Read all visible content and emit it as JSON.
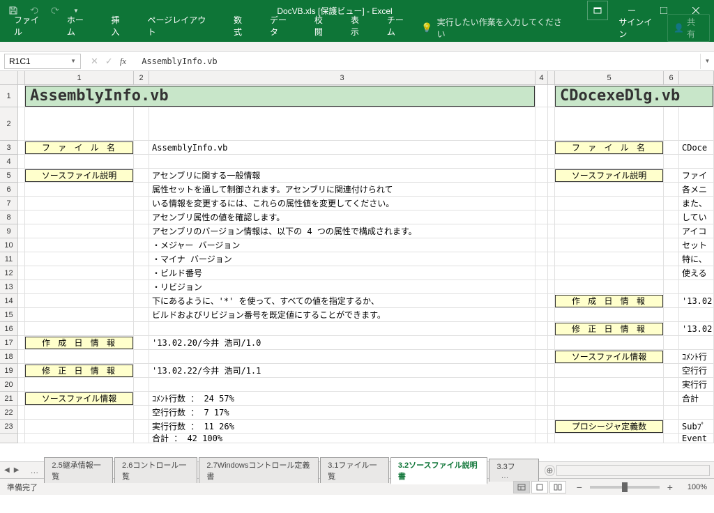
{
  "title": "DocVB.xls [保護ビュー] - Excel",
  "ribbon": {
    "tabs": [
      "ファイル",
      "ホーム",
      "挿入",
      "ページレイアウト",
      "数式",
      "データ",
      "校閲",
      "表示",
      "チーム"
    ],
    "tellme": "実行したい作業を入力してください",
    "signin": "サインイン",
    "share": "共有"
  },
  "namebox": "R1C1",
  "formula": "AssemblyInfo.vb",
  "cols": [
    "1",
    "2",
    "3",
    "4",
    "5",
    "6"
  ],
  "rows": {
    "left_header": "AssemblyInfo.vb",
    "right_header": "CDocexeDlg.vb",
    "labels": {
      "file_name": "フ ァ イ ル 名",
      "src_desc": "ソースファイル説明",
      "create_date": "作 成 日 情 報",
      "modify_date": "修 正 日 情 報",
      "src_info": "ソースファイル情報",
      "proc_def": "プロシージャ定義数"
    },
    "r3": {
      "c3": "AssemblyInfo.vb",
      "c9": "CDoce"
    },
    "r5": {
      "c3": "アセンブリに関する一般情報",
      "c9": "ファイ"
    },
    "r6": {
      "c3": "属性セットを通して制御されます。アセンブリに関連付けられて",
      "c9": "各メニ"
    },
    "r7": {
      "c3": "いる情報を変更するには、これらの属性値を変更してください。",
      "c9": "また、"
    },
    "r8": {
      "c3": "アセンブリ属性の値を確認します。",
      "c9": "してい"
    },
    "r9": {
      "c3": "アセンブリのバージョン情報は、以下の 4 つの属性で構成されます。",
      "c9": "アイコ"
    },
    "r10": {
      "c3": "・メジャー バージョン",
      "c9": "セット"
    },
    "r11": {
      "c3": "・マイナ バージョン",
      "c9": "特に、"
    },
    "r12": {
      "c3": "・ビルド番号",
      "c9": "使える"
    },
    "r13": {
      "c3": "・リビジョン"
    },
    "r14": {
      "c3": "下にあるように、'*' を使って、すべての値を指定するか、",
      "c9": "'13.02"
    },
    "r15": {
      "c3": "ビルドおよびリビジョン番号を既定値にすることができます。"
    },
    "r16": {
      "c9": "'13.02"
    },
    "r17": {
      "c3": "'13.02.20/今井 浩司/1.0"
    },
    "r18": {
      "c9": "ｺﾒﾝﾄ行"
    },
    "r19": {
      "c3": "'13.02.22/今井 浩司/1.1",
      "c9": "空行行"
    },
    "r20": {
      "c9": "実行行"
    },
    "r21": {
      "c3": "ｺﾒﾝﾄ行数 ：     24    57%",
      "c9": "合計"
    },
    "r22": {
      "c3": "空行行数 ：      7    17%"
    },
    "r23": {
      "c3": "実行行数 ：     11    26%",
      "c9_a": "Subﾌﾟ"
    },
    "r24": {
      "c3": "合計     ：     42   100%",
      "c9_a": "Event"
    }
  },
  "sheet_tabs": [
    "2.5継承情報一覧",
    "2.6コントロール一覧",
    "2.7Windowsコントロール定義書",
    "3.1ファイル一覧",
    "3.2ソースファイル説明書",
    "3.3フ"
  ],
  "active_tab": 4,
  "status": "準備完了",
  "zoom": "100%"
}
